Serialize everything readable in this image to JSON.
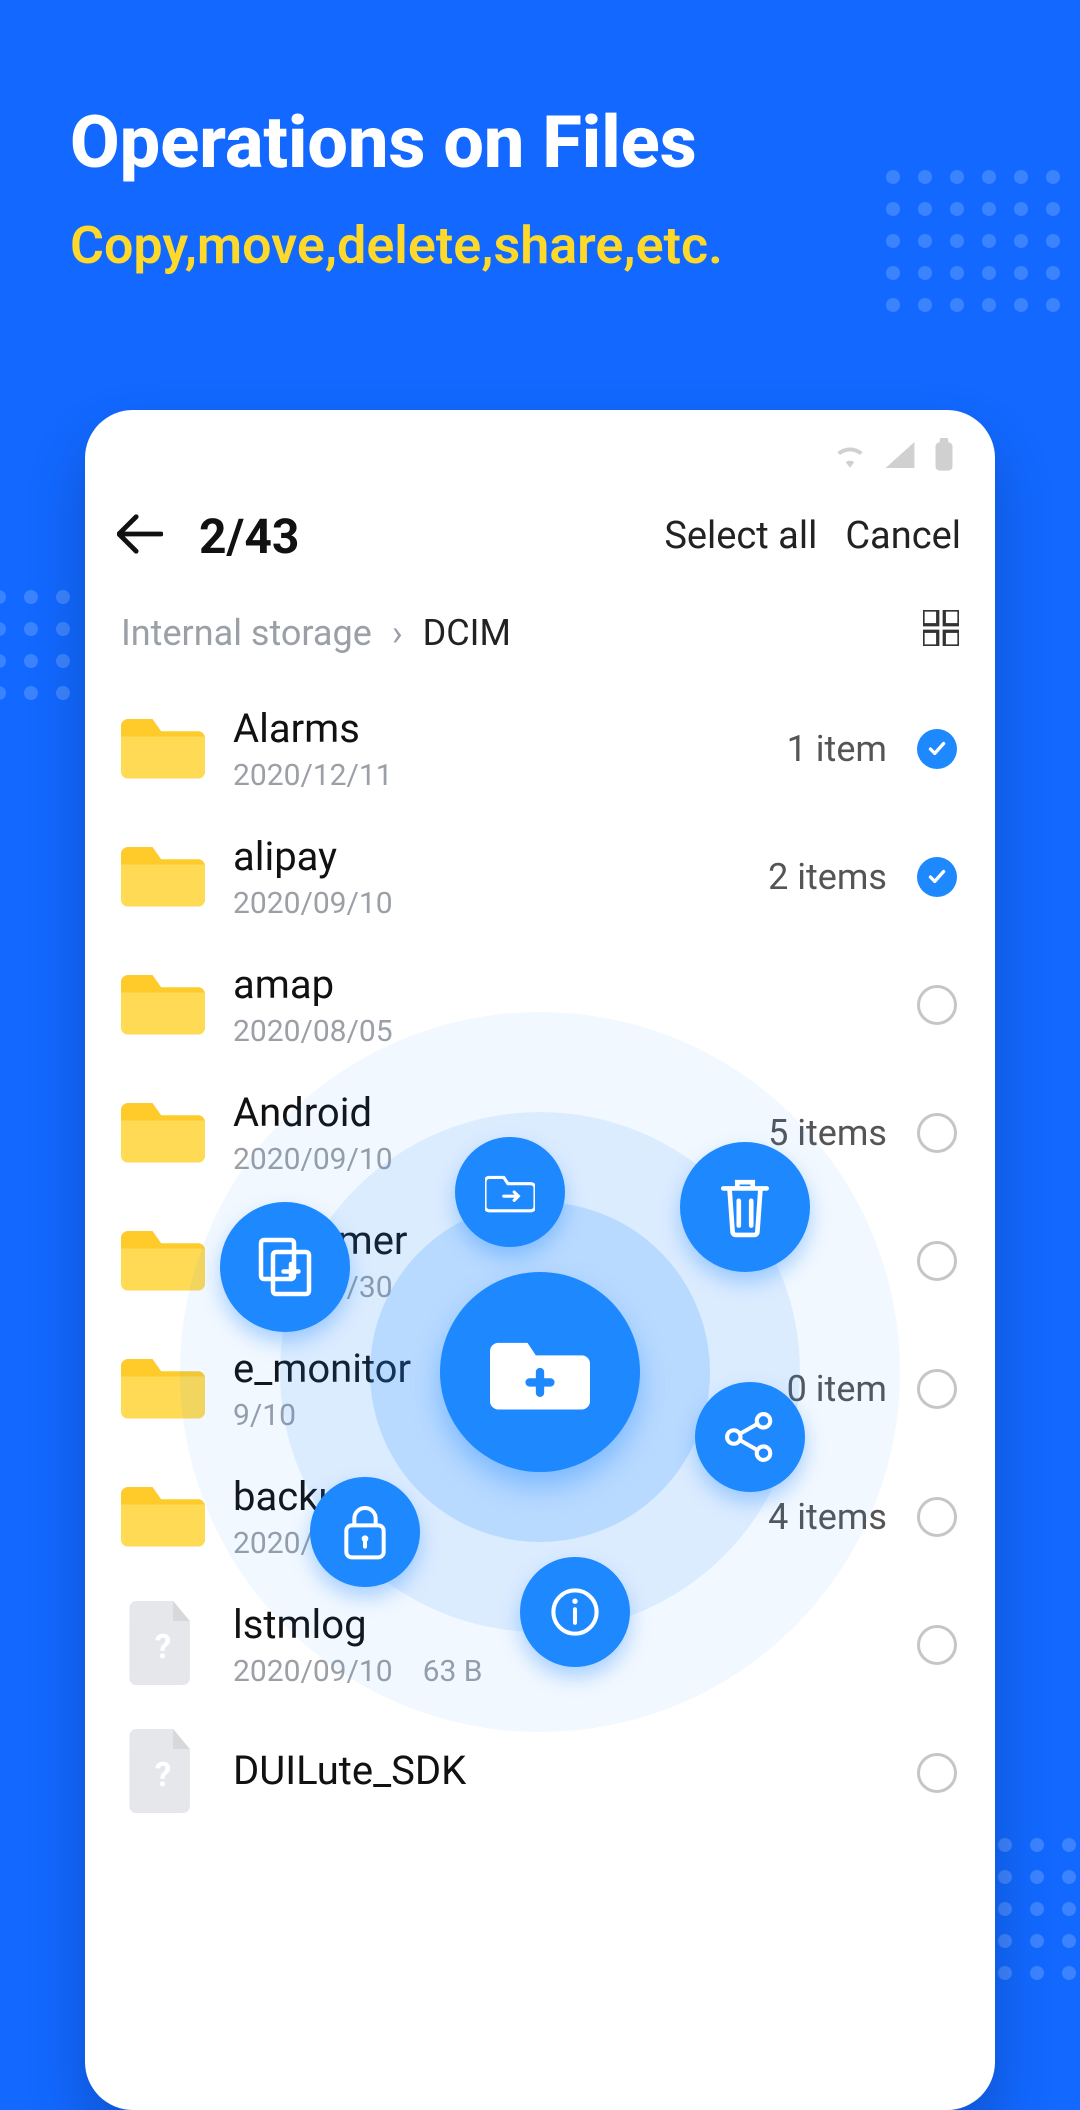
{
  "promo": {
    "title": "Operations on Files",
    "subtitle": "Copy,move,delete,share,etc."
  },
  "app_bar": {
    "counter": "2/43",
    "select_all": "Select all",
    "cancel": "Cancel"
  },
  "breadcrumb": {
    "root": "Internal storage",
    "leaf": "DCIM"
  },
  "rows": [
    {
      "type": "folder",
      "name": "Alarms",
      "date": "2020/12/11",
      "count": "1 item",
      "selected": true
    },
    {
      "type": "folder",
      "name": "alipay",
      "date": "2020/09/10",
      "count": "2 items",
      "selected": true
    },
    {
      "type": "folder",
      "name": "amap",
      "date": "2020/08/05",
      "count": "",
      "selected": false
    },
    {
      "type": "folder",
      "name": "Android",
      "date": "2020/09/10",
      "count": "5 items",
      "selected": false
    },
    {
      "type": "folder",
      "name": "AppTimer",
      "date": "2020/07/30",
      "count": "",
      "selected": false
    },
    {
      "type": "folder",
      "name": "e_monitor",
      "date": "9/10",
      "count": "0 item",
      "selected": false
    },
    {
      "type": "folder",
      "name": "backup",
      "date": "2020/11/25",
      "count": "4 items",
      "selected": false
    },
    {
      "type": "file",
      "name": "lstmlog",
      "date": "2020/09/10",
      "size": "63 B",
      "selected": false
    },
    {
      "type": "file",
      "name": "DUILute_SDK",
      "date": "",
      "size": "",
      "selected": false
    }
  ],
  "radial_actions": {
    "center": "new-folder",
    "items": [
      "move",
      "copy",
      "delete",
      "share",
      "lock",
      "info"
    ]
  }
}
